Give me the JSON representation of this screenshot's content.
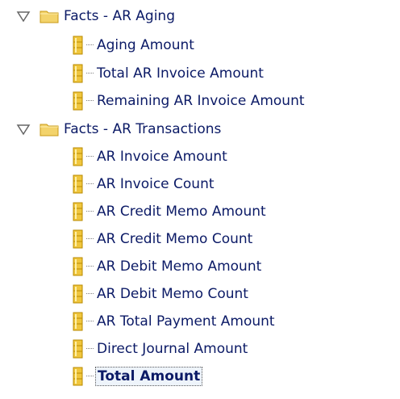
{
  "tree": {
    "groups": [
      {
        "label": "Facts - AR Aging",
        "expanded": true,
        "items": [
          "Aging Amount",
          "Total AR Invoice Amount",
          "Remaining AR Invoice Amount"
        ]
      },
      {
        "label": "Facts - AR Transactions",
        "expanded": true,
        "items": [
          "AR Invoice Amount",
          "AR Invoice Count",
          "AR Credit Memo Amount",
          "AR Credit Memo Count",
          "AR Debit Memo Amount",
          "AR Debit Memo Count",
          "AR Total Payment Amount",
          "Direct Journal Amount",
          "Total Amount"
        ]
      }
    ],
    "selected_item": "Total Amount"
  },
  "colors": {
    "text": "#0b1a66",
    "folder_fill": "#f3d36b",
    "folder_border": "#c89a15",
    "measure_icon_fill": "#f0c63d",
    "measure_icon_border": "#b88a00"
  },
  "icons": {
    "expand_toggle": "down-triangle-outline-icon",
    "group": "folder-icon",
    "item": "measure-column-icon"
  }
}
